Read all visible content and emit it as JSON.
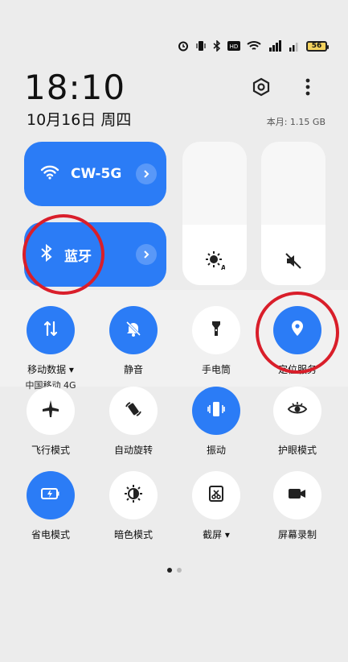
{
  "status_bar": {
    "battery_level": "56",
    "icons": [
      "alarm-icon",
      "vibrate-icon",
      "bluetooth-icon",
      "hd-icon",
      "wifi-icon",
      "signal-4g-icon",
      "signal-x-icon"
    ]
  },
  "header": {
    "time": "18:10",
    "date": "10月16日 周四",
    "data_usage": "本月: 1.15 GB"
  },
  "wide_tiles": {
    "wifi": {
      "label": "CW-5G"
    },
    "bluetooth": {
      "label": "蓝牙"
    }
  },
  "tiles": [
    {
      "label": "移动数据",
      "sub": "中国移动 4G",
      "on": true
    },
    {
      "label": "静音",
      "on": true
    },
    {
      "label": "手电筒",
      "on": false
    },
    {
      "label": "定位服务",
      "on": true
    },
    {
      "label": "飞行模式",
      "on": false
    },
    {
      "label": "自动旋转",
      "on": false
    },
    {
      "label": "振动",
      "on": true
    },
    {
      "label": "护眼模式",
      "on": false
    },
    {
      "label": "省电模式",
      "on": true
    },
    {
      "label": "暗色模式",
      "on": false
    },
    {
      "label": "截屏",
      "on": false
    },
    {
      "label": "屏幕录制",
      "on": false
    }
  ],
  "colors": {
    "accent": "#2b7cf6",
    "highlight_ring": "#d91e2a"
  },
  "page_indicator": {
    "current": 1,
    "total": 2
  }
}
